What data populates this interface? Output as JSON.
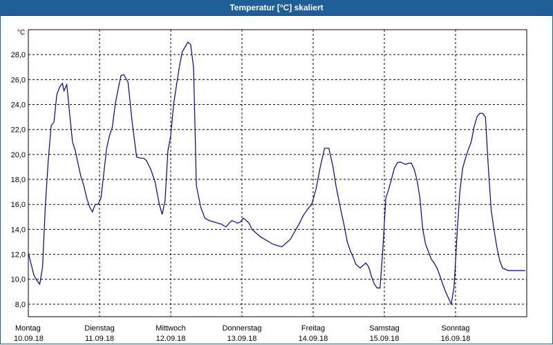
{
  "window": {
    "title": "Temperatur [°C] skaliert"
  },
  "chart_data": {
    "type": "line",
    "title": "Temperatur [°C] skaliert",
    "unit_label": "°C",
    "ylim": [
      7,
      30
    ],
    "xlim": [
      0,
      7
    ],
    "yticks": [
      8,
      10,
      12,
      14,
      16,
      18,
      20,
      22,
      24,
      26,
      28
    ],
    "ytick_labels": [
      "8,0",
      "10,0",
      "12,0",
      "14,0",
      "16,0",
      "18,0",
      "20,0",
      "22,0",
      "24,0",
      "26,0",
      "28,0"
    ],
    "day_labels": [
      {
        "day": "Montag",
        "date": "10.09.18"
      },
      {
        "day": "Dienstag",
        "date": "11.09.18"
      },
      {
        "day": "Mittwoch",
        "date": "12.09.18"
      },
      {
        "day": "Donnerstag",
        "date": "13.09.18"
      },
      {
        "day": "Freitag",
        "date": "14.09.18"
      },
      {
        "day": "Samstag",
        "date": "15.09.18"
      },
      {
        "day": "Sonntag",
        "date": "16.09.18"
      }
    ],
    "grid": true,
    "line_color": "#00008b",
    "series": [
      {
        "x": [
          0.0,
          0.04,
          0.08,
          0.12,
          0.16,
          0.2,
          0.24,
          0.28,
          0.32,
          0.36,
          0.4,
          0.44,
          0.48,
          0.5,
          0.54,
          0.58,
          0.62,
          0.66,
          0.7,
          0.74,
          0.78,
          0.82,
          0.86,
          0.9,
          0.94,
          0.98,
          1.02,
          1.06,
          1.1,
          1.14,
          1.18,
          1.22,
          1.26,
          1.3,
          1.34,
          1.4,
          1.46,
          1.52,
          1.58,
          1.62,
          1.66,
          1.72,
          1.78,
          1.84,
          1.88,
          1.92,
          1.96,
          2.0,
          2.04,
          2.08,
          2.12,
          2.16,
          2.2,
          2.24,
          2.28,
          2.32,
          2.36,
          2.42,
          2.48,
          2.54,
          2.6,
          2.66,
          2.72,
          2.74,
          2.78,
          2.82,
          2.86,
          2.9,
          2.94,
          2.98,
          3.02,
          3.06,
          3.1,
          3.14,
          3.2,
          3.26,
          3.32,
          3.38,
          3.44,
          3.5,
          3.56,
          3.62,
          3.68,
          3.74,
          3.8,
          3.86,
          3.92,
          3.98,
          4.04,
          4.1,
          4.16,
          4.22,
          4.28,
          4.32,
          4.38,
          4.44,
          4.48,
          4.52,
          4.56,
          4.6,
          4.64,
          4.66,
          4.7,
          4.74,
          4.78,
          4.82,
          4.86,
          4.9,
          4.94,
          4.98,
          5.02,
          5.06,
          5.1,
          5.14,
          5.18,
          5.22,
          5.26,
          5.3,
          5.34,
          5.38,
          5.42,
          5.46,
          5.5,
          5.54,
          5.58,
          5.62,
          5.66,
          5.7,
          5.74,
          5.78,
          5.82,
          5.86,
          5.9,
          5.94,
          5.98,
          6.02,
          6.06,
          6.1,
          6.14,
          6.18,
          6.22,
          6.26,
          6.3,
          6.34,
          6.38,
          6.42,
          6.46,
          6.5,
          6.54,
          6.58,
          6.62,
          6.66,
          6.7,
          6.74,
          6.78,
          6.82,
          6.86,
          6.9,
          6.94,
          6.98
        ],
        "y": [
          12.1,
          11.2,
          10.3,
          9.9,
          9.6,
          11.0,
          16.0,
          19.5,
          22.3,
          22.6,
          24.8,
          25.4,
          25.7,
          25.1,
          25.6,
          23.3,
          21.0,
          20.3,
          19.2,
          18.2,
          17.5,
          16.5,
          15.8,
          15.4,
          16.0,
          16.0,
          16.5,
          18.5,
          20.5,
          21.5,
          22.2,
          24.0,
          25.2,
          26.3,
          26.4,
          25.8,
          22.5,
          19.8,
          19.7,
          19.7,
          19.5,
          18.8,
          17.8,
          16.0,
          15.2,
          16.3,
          20.3,
          21.5,
          24.0,
          25.5,
          27.0,
          28.2,
          28.6,
          29.0,
          28.8,
          27.0,
          17.5,
          15.8,
          14.9,
          14.7,
          14.6,
          14.5,
          14.4,
          14.3,
          14.2,
          14.5,
          14.7,
          14.6,
          14.5,
          14.6,
          14.9,
          14.7,
          14.5,
          14.0,
          13.7,
          13.4,
          13.2,
          13.0,
          12.8,
          12.7,
          12.6,
          12.9,
          13.2,
          13.8,
          14.4,
          15.1,
          15.6,
          16.0,
          17.2,
          19.0,
          20.5,
          20.5,
          19.0,
          17.5,
          15.8,
          14.2,
          13.0,
          12.3,
          11.8,
          11.2,
          11.0,
          10.9,
          11.1,
          11.3,
          11.0,
          10.2,
          9.6,
          9.3,
          9.3,
          12.5,
          16.5,
          17.2,
          18.0,
          18.9,
          19.3,
          19.4,
          19.3,
          19.2,
          19.3,
          19.3,
          18.8,
          17.9,
          16.5,
          14.0,
          12.8,
          12.2,
          11.6,
          11.3,
          10.9,
          10.3,
          9.6,
          9.0,
          8.5,
          8.0,
          9.4,
          13.5,
          17.0,
          18.9,
          19.7,
          20.4,
          21.0,
          22.2,
          23.0,
          23.3,
          23.3,
          23.0,
          19.0,
          15.6,
          14.0,
          12.6,
          11.5,
          10.9,
          10.8,
          10.7,
          10.7,
          10.7,
          10.7,
          10.7,
          10.7,
          10.7
        ]
      }
    ]
  }
}
